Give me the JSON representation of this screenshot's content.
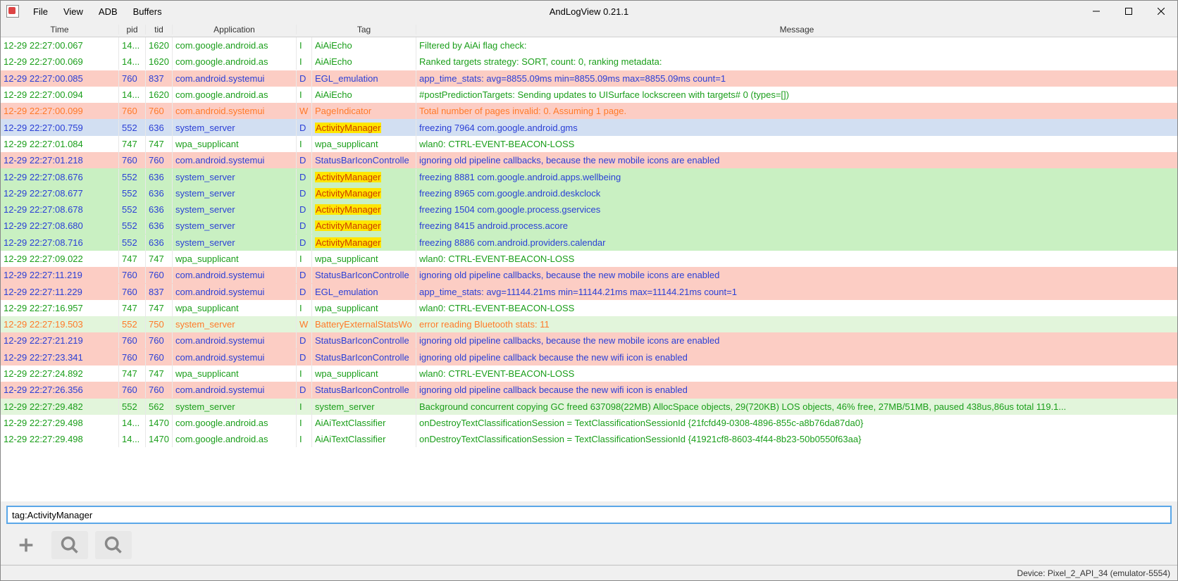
{
  "window": {
    "title": "AndLogView 0.21.1",
    "menu": [
      "File",
      "View",
      "ADB",
      "Buffers"
    ]
  },
  "columns": {
    "time": "Time",
    "pid": "pid",
    "tid": "tid",
    "app": "Application",
    "lvl": "",
    "tag": "Tag",
    "msg": "Message"
  },
  "filter": {
    "value": "tag:ActivityManager"
  },
  "status": {
    "device": "Device: Pixel_2_API_34 (emulator-5554)"
  },
  "highlight_tag": "ActivityManager",
  "rows": [
    {
      "time": "12-29 22:27:00.067",
      "pid": "14...",
      "tid": "1620",
      "app": "com.google.android.as",
      "lvl": "I",
      "tag": "AiAiEcho",
      "msg": "Filtered by AiAi flag check:",
      "bg": "white"
    },
    {
      "time": "12-29 22:27:00.069",
      "pid": "14...",
      "tid": "1620",
      "app": "com.google.android.as",
      "lvl": "I",
      "tag": "AiAiEcho",
      "msg": "Ranked targets strategy: SORT, count: 0, ranking metadata:",
      "bg": "white"
    },
    {
      "time": "12-29 22:27:00.085",
      "pid": "760",
      "tid": "837",
      "app": "com.android.systemui",
      "lvl": "D",
      "tag": "EGL_emulation",
      "msg": "app_time_stats: avg=8855.09ms min=8855.09ms max=8855.09ms count=1",
      "bg": "pink"
    },
    {
      "time": "12-29 22:27:00.094",
      "pid": "14...",
      "tid": "1620",
      "app": "com.google.android.as",
      "lvl": "I",
      "tag": "AiAiEcho",
      "msg": "#postPredictionTargets: Sending updates to UISurface lockscreen with targets# 0 (types=[])",
      "bg": "white"
    },
    {
      "time": "12-29 22:27:00.099",
      "pid": "760",
      "tid": "760",
      "app": "com.android.systemui",
      "lvl": "W",
      "tag": "PageIndicator",
      "msg": "Total number of pages invalid: 0. Assuming 1 page.",
      "bg": "pink"
    },
    {
      "time": "12-29 22:27:00.759",
      "pid": "552",
      "tid": "636",
      "app": "system_server",
      "lvl": "D",
      "tag": "ActivityManager",
      "msg": "freezing 7964 com.google.android.gms",
      "bg": "blue"
    },
    {
      "time": "12-29 22:27:01.084",
      "pid": "747",
      "tid": "747",
      "app": "wpa_supplicant",
      "lvl": "I",
      "tag": "wpa_supplicant",
      "msg": "wlan0: CTRL-EVENT-BEACON-LOSS",
      "bg": "white"
    },
    {
      "time": "12-29 22:27:01.218",
      "pid": "760",
      "tid": "760",
      "app": "com.android.systemui",
      "lvl": "D",
      "tag": "StatusBarIconControlle",
      "msg": "ignoring old pipeline callbacks, because the new mobile icons are enabled",
      "bg": "pink"
    },
    {
      "time": "12-29 22:27:08.676",
      "pid": "552",
      "tid": "636",
      "app": "system_server",
      "lvl": "D",
      "tag": "ActivityManager",
      "msg": "freezing 8881 com.google.android.apps.wellbeing",
      "bg": "green"
    },
    {
      "time": "12-29 22:27:08.677",
      "pid": "552",
      "tid": "636",
      "app": "system_server",
      "lvl": "D",
      "tag": "ActivityManager",
      "msg": "freezing 8965 com.google.android.deskclock",
      "bg": "green"
    },
    {
      "time": "12-29 22:27:08.678",
      "pid": "552",
      "tid": "636",
      "app": "system_server",
      "lvl": "D",
      "tag": "ActivityManager",
      "msg": "freezing 1504 com.google.process.gservices",
      "bg": "green"
    },
    {
      "time": "12-29 22:27:08.680",
      "pid": "552",
      "tid": "636",
      "app": "system_server",
      "lvl": "D",
      "tag": "ActivityManager",
      "msg": "freezing 8415 android.process.acore",
      "bg": "green"
    },
    {
      "time": "12-29 22:27:08.716",
      "pid": "552",
      "tid": "636",
      "app": "system_server",
      "lvl": "D",
      "tag": "ActivityManager",
      "msg": "freezing 8886 com.android.providers.calendar",
      "bg": "green"
    },
    {
      "time": "12-29 22:27:09.022",
      "pid": "747",
      "tid": "747",
      "app": "wpa_supplicant",
      "lvl": "I",
      "tag": "wpa_supplicant",
      "msg": "wlan0: CTRL-EVENT-BEACON-LOSS",
      "bg": "white"
    },
    {
      "time": "12-29 22:27:11.219",
      "pid": "760",
      "tid": "760",
      "app": "com.android.systemui",
      "lvl": "D",
      "tag": "StatusBarIconControlle",
      "msg": "ignoring old pipeline callbacks, because the new mobile icons are enabled",
      "bg": "pink"
    },
    {
      "time": "12-29 22:27:11.229",
      "pid": "760",
      "tid": "837",
      "app": "com.android.systemui",
      "lvl": "D",
      "tag": "EGL_emulation",
      "msg": "app_time_stats: avg=11144.21ms min=11144.21ms max=11144.21ms count=1",
      "bg": "pink"
    },
    {
      "time": "12-29 22:27:16.957",
      "pid": "747",
      "tid": "747",
      "app": "wpa_supplicant",
      "lvl": "I",
      "tag": "wpa_supplicant",
      "msg": "wlan0: CTRL-EVENT-BEACON-LOSS",
      "bg": "white"
    },
    {
      "time": "12-29 22:27:19.503",
      "pid": "552",
      "tid": "750",
      "app": "system_server",
      "lvl": "W",
      "tag": "BatteryExternalStatsWo",
      "msg": "error reading Bluetooth stats: 11",
      "bg": "lgreen"
    },
    {
      "time": "12-29 22:27:21.219",
      "pid": "760",
      "tid": "760",
      "app": "com.android.systemui",
      "lvl": "D",
      "tag": "StatusBarIconControlle",
      "msg": "ignoring old pipeline callbacks, because the new mobile icons are enabled",
      "bg": "pink"
    },
    {
      "time": "12-29 22:27:23.341",
      "pid": "760",
      "tid": "760",
      "app": "com.android.systemui",
      "lvl": "D",
      "tag": "StatusBarIconControlle",
      "msg": "ignoring old pipeline callback because the new wifi icon is enabled",
      "bg": "pink"
    },
    {
      "time": "12-29 22:27:24.892",
      "pid": "747",
      "tid": "747",
      "app": "wpa_supplicant",
      "lvl": "I",
      "tag": "wpa_supplicant",
      "msg": "wlan0: CTRL-EVENT-BEACON-LOSS",
      "bg": "white"
    },
    {
      "time": "12-29 22:27:26.356",
      "pid": "760",
      "tid": "760",
      "app": "com.android.systemui",
      "lvl": "D",
      "tag": "StatusBarIconControlle",
      "msg": "ignoring old pipeline callback because the new wifi icon is enabled",
      "bg": "pink"
    },
    {
      "time": "12-29 22:27:29.482",
      "pid": "552",
      "tid": "562",
      "app": "system_server",
      "lvl": "I",
      "tag": "system_server",
      "msg": "Background concurrent copying GC freed 637098(22MB) AllocSpace objects, 29(720KB) LOS objects, 46% free, 27MB/51MB, paused 438us,86us total 119.1...",
      "bg": "lgreen"
    },
    {
      "time": "12-29 22:27:29.498",
      "pid": "14...",
      "tid": "1470",
      "app": "com.google.android.as",
      "lvl": "I",
      "tag": "AiAiTextClassifier",
      "msg": "onDestroyTextClassificationSession = TextClassificationSessionId {21fcfd49-0308-4896-855c-a8b76da87da0}",
      "bg": "white"
    },
    {
      "time": "12-29 22:27:29.498",
      "pid": "14...",
      "tid": "1470",
      "app": "com.google.android.as",
      "lvl": "I",
      "tag": "AiAiTextClassifier",
      "msg": "onDestroyTextClassificationSession = TextClassificationSessionId {41921cf8-8603-4f44-8b23-50b0550f63aa}",
      "bg": "white"
    }
  ]
}
